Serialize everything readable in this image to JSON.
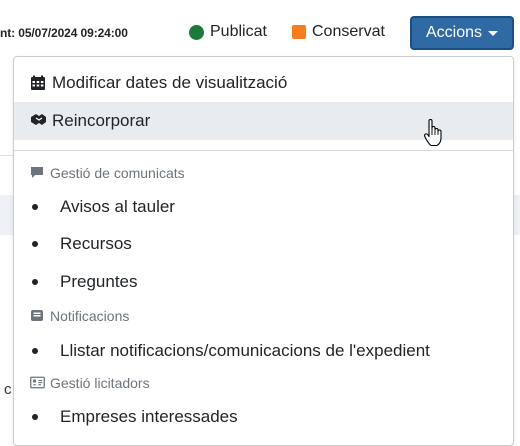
{
  "topbar": {
    "timestamp": "nt: 05/07/2024 09:24:00",
    "status_published": "Publicat",
    "status_conserved": "Conservat",
    "actions_label": "Accions",
    "colors": {
      "published": "#1d7a3a",
      "conserved": "#f47d20",
      "button": "#2f6aa5"
    }
  },
  "menu": {
    "top_items": [
      {
        "label": "Modificar dates de visualització",
        "icon": "calendar-icon"
      },
      {
        "label": "Reincorporar",
        "icon": "hand-icon",
        "hovered": true
      }
    ],
    "sections": [
      {
        "header": "Gestió de comunicats",
        "icon": "comment-icon",
        "items": [
          "Avisos al tauler",
          "Recursos",
          "Preguntes"
        ]
      },
      {
        "header": "Notificacions",
        "icon": "envelope-icon",
        "items": [
          "Llistar notificacions/comunicacions de l'expedient"
        ]
      },
      {
        "header": "Gestió licitadors",
        "icon": "id-card-icon",
        "items": [
          "Empreses interessades"
        ]
      }
    ]
  },
  "background": {
    "partial_letter": "c"
  }
}
